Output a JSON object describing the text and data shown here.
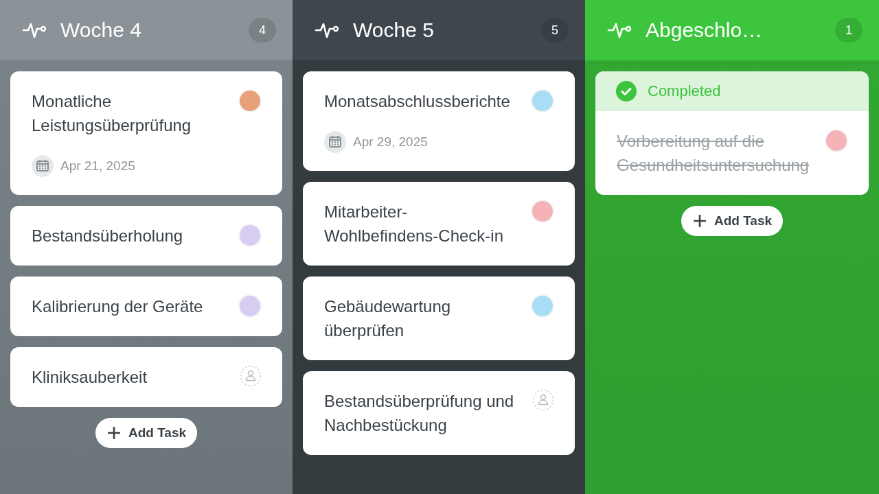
{
  "columns": [
    {
      "title": "Woche 4",
      "count": "4",
      "kind": "grey",
      "cards": [
        {
          "title": "Monatliche Leistungsüberprüfung",
          "date": "Apr 21, 2025",
          "completed": false,
          "assignee": {
            "kind": "avatar",
            "color": "#e8a07a"
          }
        },
        {
          "title": "Bestandsüberholung",
          "completed": false,
          "assignee": {
            "kind": "avatar",
            "color": "#d9ccf2"
          }
        },
        {
          "title": "Kalibrierung der Geräte",
          "completed": false,
          "assignee": {
            "kind": "avatar",
            "color": "#d9ccf2"
          }
        },
        {
          "title": "Kliniksauberkeit",
          "completed": false,
          "assignee": {
            "kind": "unassigned"
          }
        }
      ],
      "add_label": "Add Task"
    },
    {
      "title": "Woche 5",
      "count": "5",
      "kind": "dark",
      "cards": [
        {
          "title": "Monatsabschlussberichte",
          "date": "Apr 29, 2025",
          "completed": false,
          "assignee": {
            "kind": "avatar",
            "color": "#a9dcf5"
          }
        },
        {
          "title": "Mitarbeiter-Wohlbefindens-Check-in",
          "completed": false,
          "assignee": {
            "kind": "avatar",
            "color": "#f5b3b8"
          }
        },
        {
          "title": "Gebäudewartung überprüfen",
          "completed": false,
          "assignee": {
            "kind": "avatar",
            "color": "#a9dcf5"
          }
        },
        {
          "title": "Bestandsüberprüfung und Nachbestückung",
          "completed": false,
          "assignee": {
            "kind": "unassigned"
          }
        }
      ]
    },
    {
      "title": "Abgeschlo…",
      "count": "1",
      "kind": "green",
      "cards": [
        {
          "status_label": "Completed",
          "title": "Vorbereitung auf die Gesundheitsuntersuchung",
          "completed": true,
          "assignee": {
            "kind": "avatar",
            "color": "#f5b3b8"
          }
        }
      ],
      "add_label": "Add Task"
    }
  ]
}
